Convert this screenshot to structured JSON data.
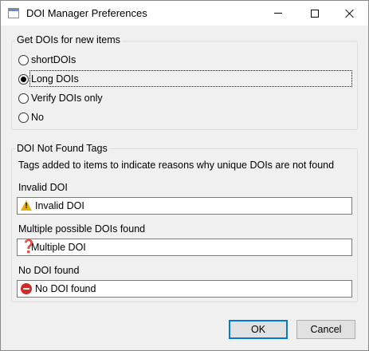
{
  "window": {
    "title": "DOI Manager Preferences"
  },
  "new_items_group": {
    "title": "Get DOIs for new items",
    "options": [
      {
        "label": "shortDOIs",
        "selected": false
      },
      {
        "label": "Long DOIs",
        "selected": true
      },
      {
        "label": "Verify DOIs only",
        "selected": false
      },
      {
        "label": "No",
        "selected": false
      }
    ]
  },
  "tags_group": {
    "title": "DOI Not Found Tags",
    "description": "Tags added to items to indicate reasons why unique DOIs are not found",
    "fields": [
      {
        "label": "Invalid DOI",
        "value": "Invalid DOI",
        "icon": "warning-icon"
      },
      {
        "label": "Multiple possible DOIs found",
        "value": "Multiple DOI",
        "icon": "question-icon"
      },
      {
        "label": "No DOI found",
        "value": "No DOI found",
        "icon": "no-entry-icon"
      }
    ]
  },
  "buttons": {
    "ok": "OK",
    "cancel": "Cancel"
  },
  "colors": {
    "accent": "#0078d7",
    "warning": "#e8b007",
    "question": "#b5221f",
    "no_entry": "#d42a26"
  }
}
